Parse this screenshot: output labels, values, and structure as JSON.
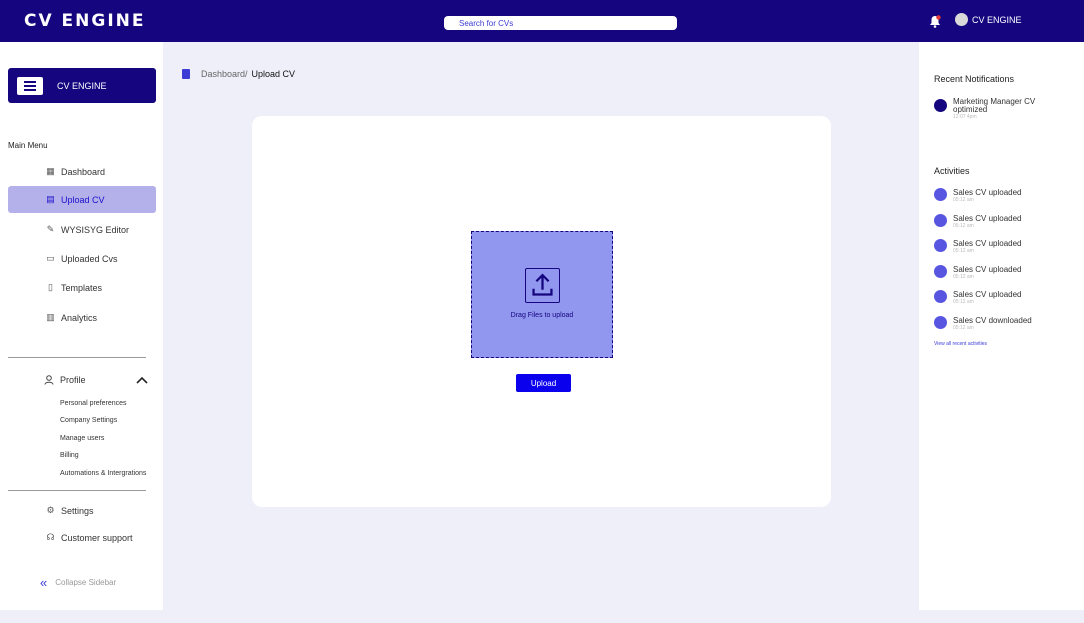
{
  "header": {
    "logo": "CV ENGINE",
    "search_placeholder": "Search for CVs",
    "user_name": "CV ENGINE",
    "accent": "#150680"
  },
  "sidebar": {
    "brand": "CV ENGINE",
    "menu_title": "Main Menu",
    "items": [
      {
        "label": "Dashboard",
        "icon": "dashboard-icon"
      },
      {
        "label": "Upload CV",
        "icon": "upload-file-icon",
        "active": true
      },
      {
        "label": "WYSISYG Editor",
        "icon": "pencil-icon"
      },
      {
        "label": "Uploaded Cvs",
        "icon": "clipboard-icon"
      },
      {
        "label": "Templates",
        "icon": "document-icon"
      },
      {
        "label": "Analytics",
        "icon": "chart-icon"
      }
    ],
    "profile": {
      "label": "Profile",
      "sub_items": [
        "Personal preferences",
        "Company Settings",
        "Manage users",
        "Billing",
        "Automations & Intergrations"
      ]
    },
    "settings": "Settings",
    "support": "Customer support",
    "collapse": "Collapse Sidebar"
  },
  "breadcrumb": {
    "parent": "Dashboard/",
    "current": "Upload CV"
  },
  "upload": {
    "dropzone_text": "Drag Files to upload",
    "button": "Upload"
  },
  "right_panel": {
    "notifications_title": "Recent Notifications",
    "notification": {
      "text": "Marketing Manager CV optimized",
      "time": "12:07 4pm"
    },
    "activities_title": "Activities",
    "activities": [
      {
        "text": "Sales  CV uploaded",
        "time": "05:12 am"
      },
      {
        "text": "Sales CV uploaded",
        "time": "05:12 am"
      },
      {
        "text": "Sales CV uploaded",
        "time": "05:12 am"
      },
      {
        "text": "Sales  CV uploaded",
        "time": "05:12 am"
      },
      {
        "text": "Sales CV uploaded",
        "time": "05:12 am"
      },
      {
        "text": "Sales CV downloaded",
        "time": "05:12 am"
      }
    ],
    "view_all": "View all recent activities"
  }
}
